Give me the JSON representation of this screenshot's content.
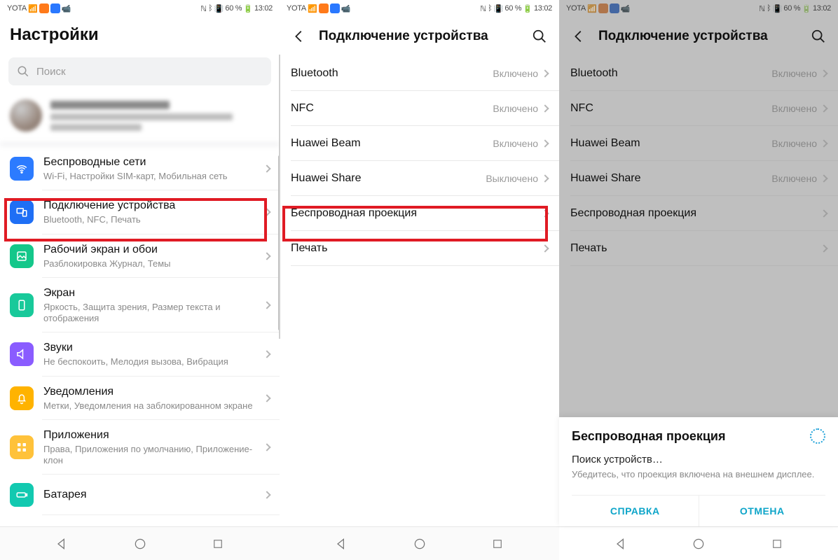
{
  "statusbar": {
    "carrier": "YOTA",
    "battery": "60 %",
    "time": "13:02"
  },
  "panel1": {
    "title": "Настройки",
    "search_placeholder": "Поиск",
    "rows": [
      {
        "label": "Беспроводные сети",
        "sub": "Wi-Fi, Настройки SIM-карт, Мобильная сеть"
      },
      {
        "label": "Подключение устройства",
        "sub": "Bluetooth, NFC, Печать"
      },
      {
        "label": "Рабочий экран и обои",
        "sub": "Разблокировка Журнал, Темы"
      },
      {
        "label": "Экран",
        "sub": "Яркость, Защита зрения, Размер текста и отображения"
      },
      {
        "label": "Звуки",
        "sub": "Не беспокоить, Мелодия вызова, Вибрация"
      },
      {
        "label": "Уведомления",
        "sub": "Метки, Уведомления на заблокированном экране"
      },
      {
        "label": "Приложения",
        "sub": "Права, Приложения по умолчанию, Приложение-клон"
      },
      {
        "label": "Батарея",
        "sub": ""
      }
    ]
  },
  "panel2": {
    "title": "Подключение устройства",
    "rows": [
      {
        "label": "Bluetooth",
        "value": "Включено"
      },
      {
        "label": "NFC",
        "value": "Включено"
      },
      {
        "label": "Huawei Beam",
        "value": "Включено"
      },
      {
        "label": "Huawei Share",
        "value": "Выключено"
      },
      {
        "label": "Беспроводная проекция",
        "value": ""
      },
      {
        "label": "Печать",
        "value": ""
      }
    ]
  },
  "panel3": {
    "title": "Подключение устройства",
    "rows": [
      {
        "label": "Bluetooth",
        "value": "Включено"
      },
      {
        "label": "NFC",
        "value": "Включено"
      },
      {
        "label": "Huawei Beam",
        "value": "Включено"
      },
      {
        "label": "Huawei Share",
        "value": "Включено"
      },
      {
        "label": "Беспроводная проекция",
        "value": ""
      },
      {
        "label": "Печать",
        "value": ""
      }
    ],
    "sheet": {
      "title": "Беспроводная проекция",
      "line1": "Поиск устройств…",
      "line2": "Убедитесь, что проекция включена на внешнем дисплее.",
      "btn_help": "СПРАВКА",
      "btn_cancel": "ОТМЕНА"
    }
  }
}
